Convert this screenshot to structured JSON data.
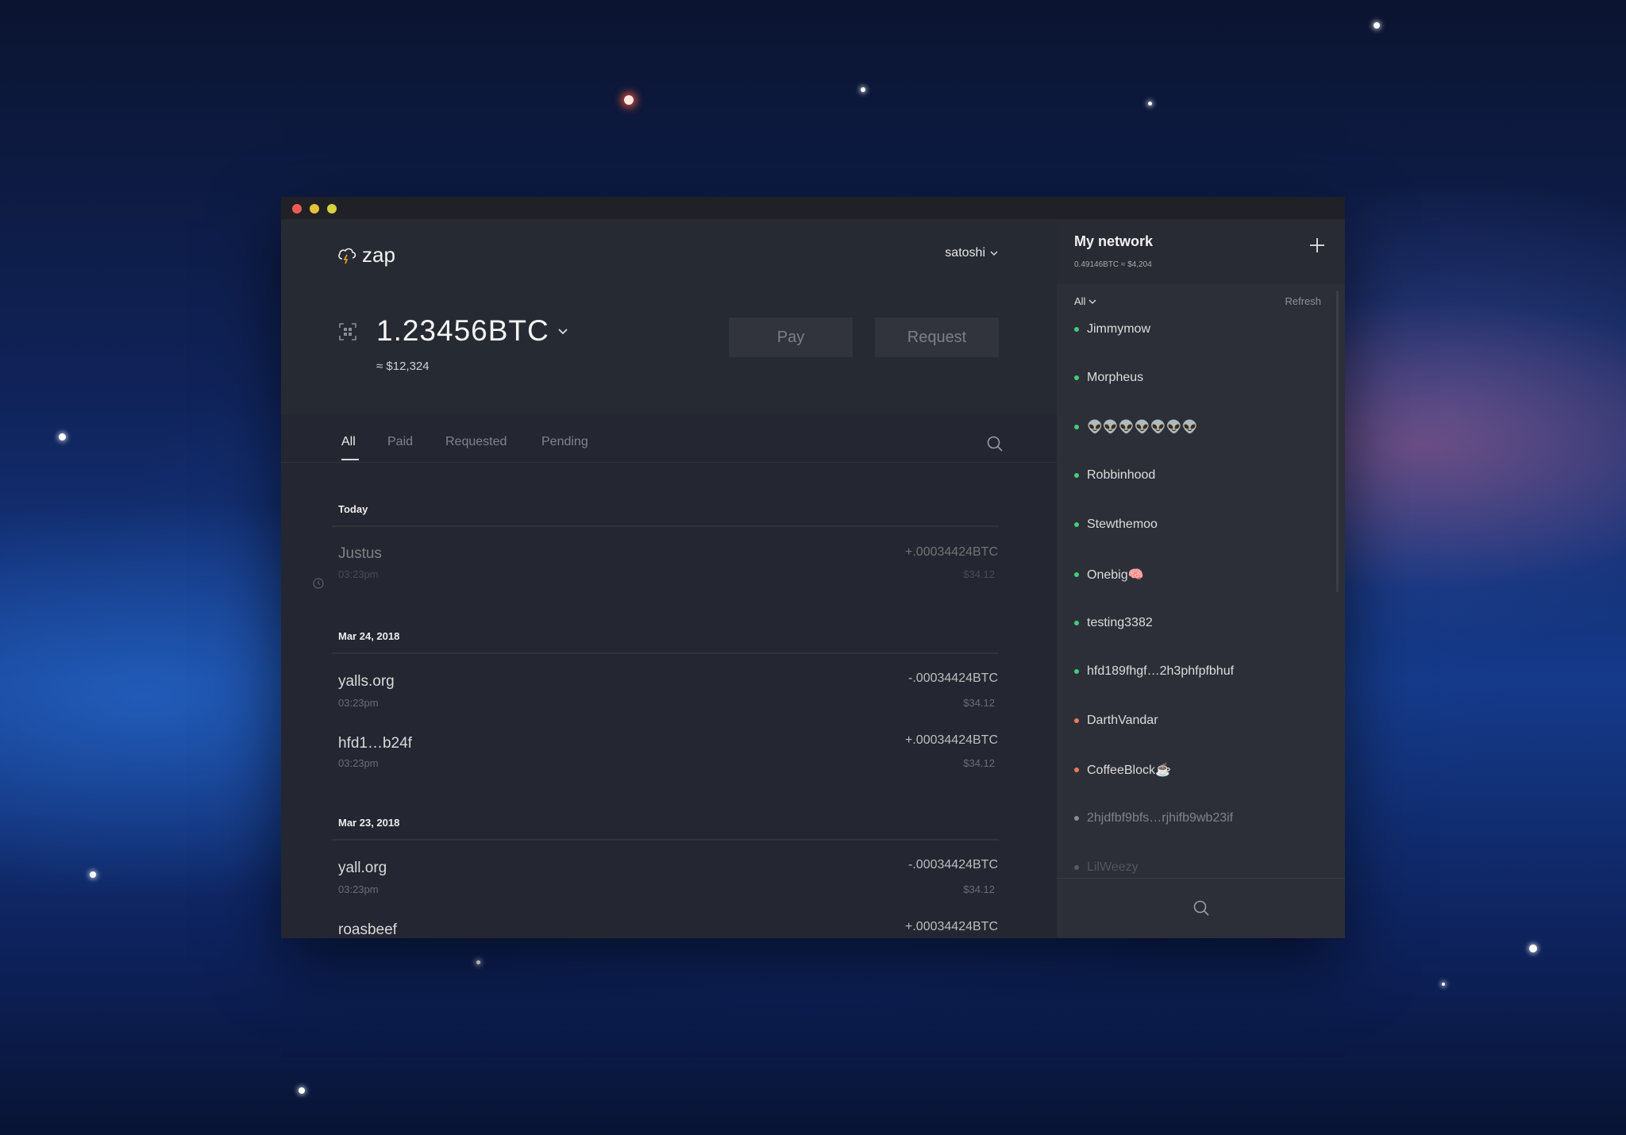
{
  "app": {
    "name": "zap"
  },
  "header": {
    "user": "satoshi",
    "balance": "1.23456BTC",
    "fiat": "≈ $12,324",
    "pay_label": "Pay",
    "request_label": "Request"
  },
  "tabs": [
    "All",
    "Paid",
    "Requested",
    "Pending"
  ],
  "activity": {
    "groups": [
      {
        "date": "Today",
        "items": [
          {
            "name": "Justus",
            "time": "03:23pm",
            "amount": "+.00034424BTC",
            "usd": "$34.12",
            "pending": true
          }
        ]
      },
      {
        "date": "Mar 24, 2018",
        "items": [
          {
            "name": "yalls.org",
            "time": "03:23pm",
            "amount": "-.00034424BTC",
            "usd": "$34.12"
          },
          {
            "name": "hfd1…b24f",
            "time": "03:23pm",
            "amount": "+.00034424BTC",
            "usd": "$34.12"
          }
        ]
      },
      {
        "date": "Mar 23, 2018",
        "items": [
          {
            "name": "yall.org",
            "time": "03:23pm",
            "amount": "-.00034424BTC",
            "usd": "$34.12"
          },
          {
            "name": "roasbeef",
            "time": "",
            "amount": "+.00034424BTC",
            "usd": ""
          }
        ]
      }
    ]
  },
  "network": {
    "title": "My network",
    "subtitle": "0.49146BTC ≈ $4,204",
    "filter": "All",
    "refresh": "Refresh",
    "peers": [
      {
        "name": "Jimmymow",
        "status_color": "#3fcf75"
      },
      {
        "name": "Morpheus",
        "status_color": "#3fcf75"
      },
      {
        "name": "👽👽👽👽👽👽👽",
        "status_color": "#3fcf75"
      },
      {
        "name": "Robbinhood",
        "status_color": "#3fcf75"
      },
      {
        "name": "Stewthemoo",
        "status_color": "#3fcf75"
      },
      {
        "name": "Onebig🧠",
        "status_color": "#3fcf75"
      },
      {
        "name": "testing3382",
        "status_color": "#3fcf75"
      },
      {
        "name": "hfd189fhgf…2h3phfpfbhuf",
        "status_color": "#3fcf75"
      },
      {
        "name": "DarthVandar",
        "status_color": "#f07a54"
      },
      {
        "name": "CoffeeBlock☕",
        "status_color": "#f07a54"
      },
      {
        "name": "2hjdfbf9bfs…rjhifb9wb23if",
        "status_color": "#8a8d94"
      },
      {
        "name": "LilWeezy",
        "status_color": "#8a8d94"
      }
    ]
  }
}
